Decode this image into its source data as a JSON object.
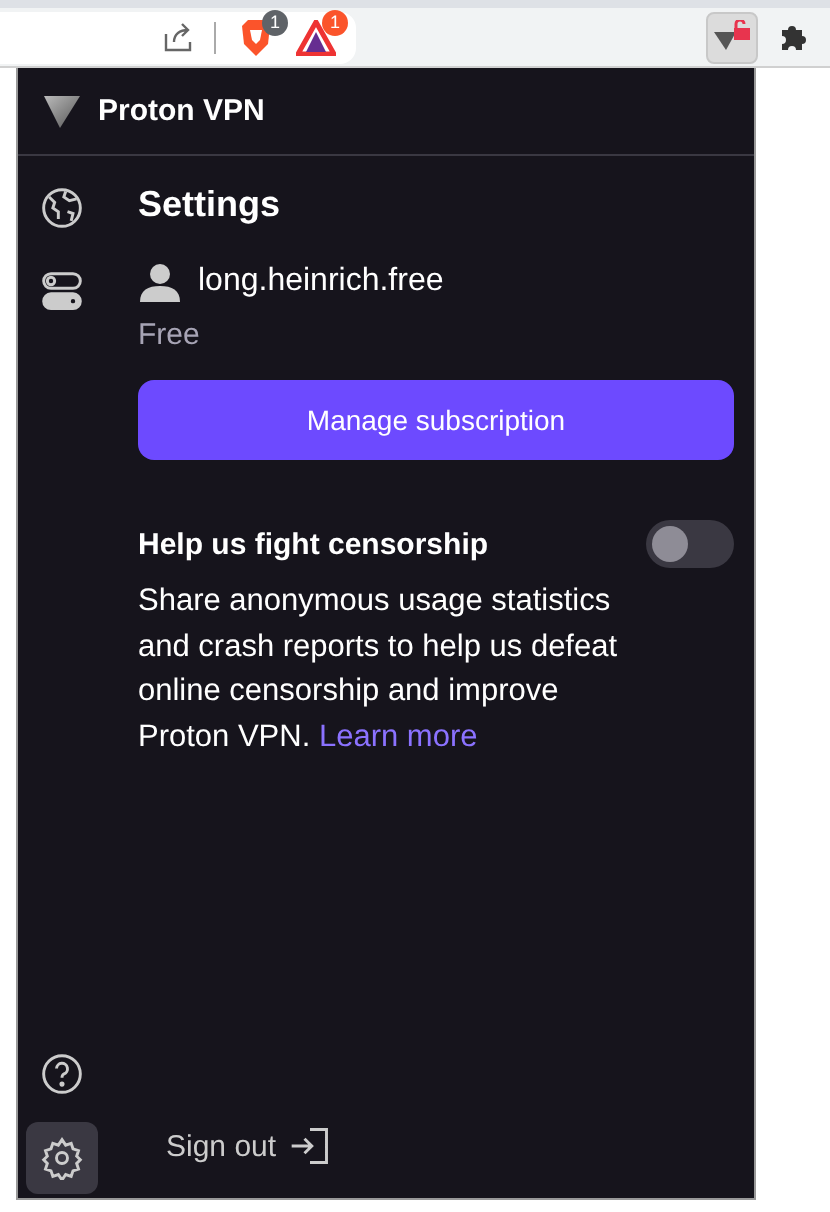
{
  "toolbar": {
    "extensions": [
      {
        "kind": "brave",
        "badge": "1"
      },
      {
        "kind": "triangle",
        "badge": "1"
      }
    ],
    "pinned": [
      {
        "kind": "vpn",
        "selected": true
      },
      {
        "kind": "puzzle",
        "selected": false
      }
    ]
  },
  "popup": {
    "brand": "Proton VPN",
    "nav_top": [
      {
        "kind": "globe",
        "selected": false
      },
      {
        "kind": "toggles",
        "selected": false
      }
    ],
    "nav_bottom": [
      {
        "kind": "help",
        "selected": false
      },
      {
        "kind": "settings",
        "selected": true
      }
    ],
    "title": "Settings",
    "username": "long.heinrich.free",
    "plan": "Free",
    "manage_button": "Manage subscription",
    "telemetry": {
      "heading": "Help us fight censorship",
      "on": false,
      "text": "Share anonymous usage statistics and crash reports to help us defeat online censorship and improve Proton VPN.",
      "link": "Learn more"
    },
    "sign_out": "Sign out"
  }
}
